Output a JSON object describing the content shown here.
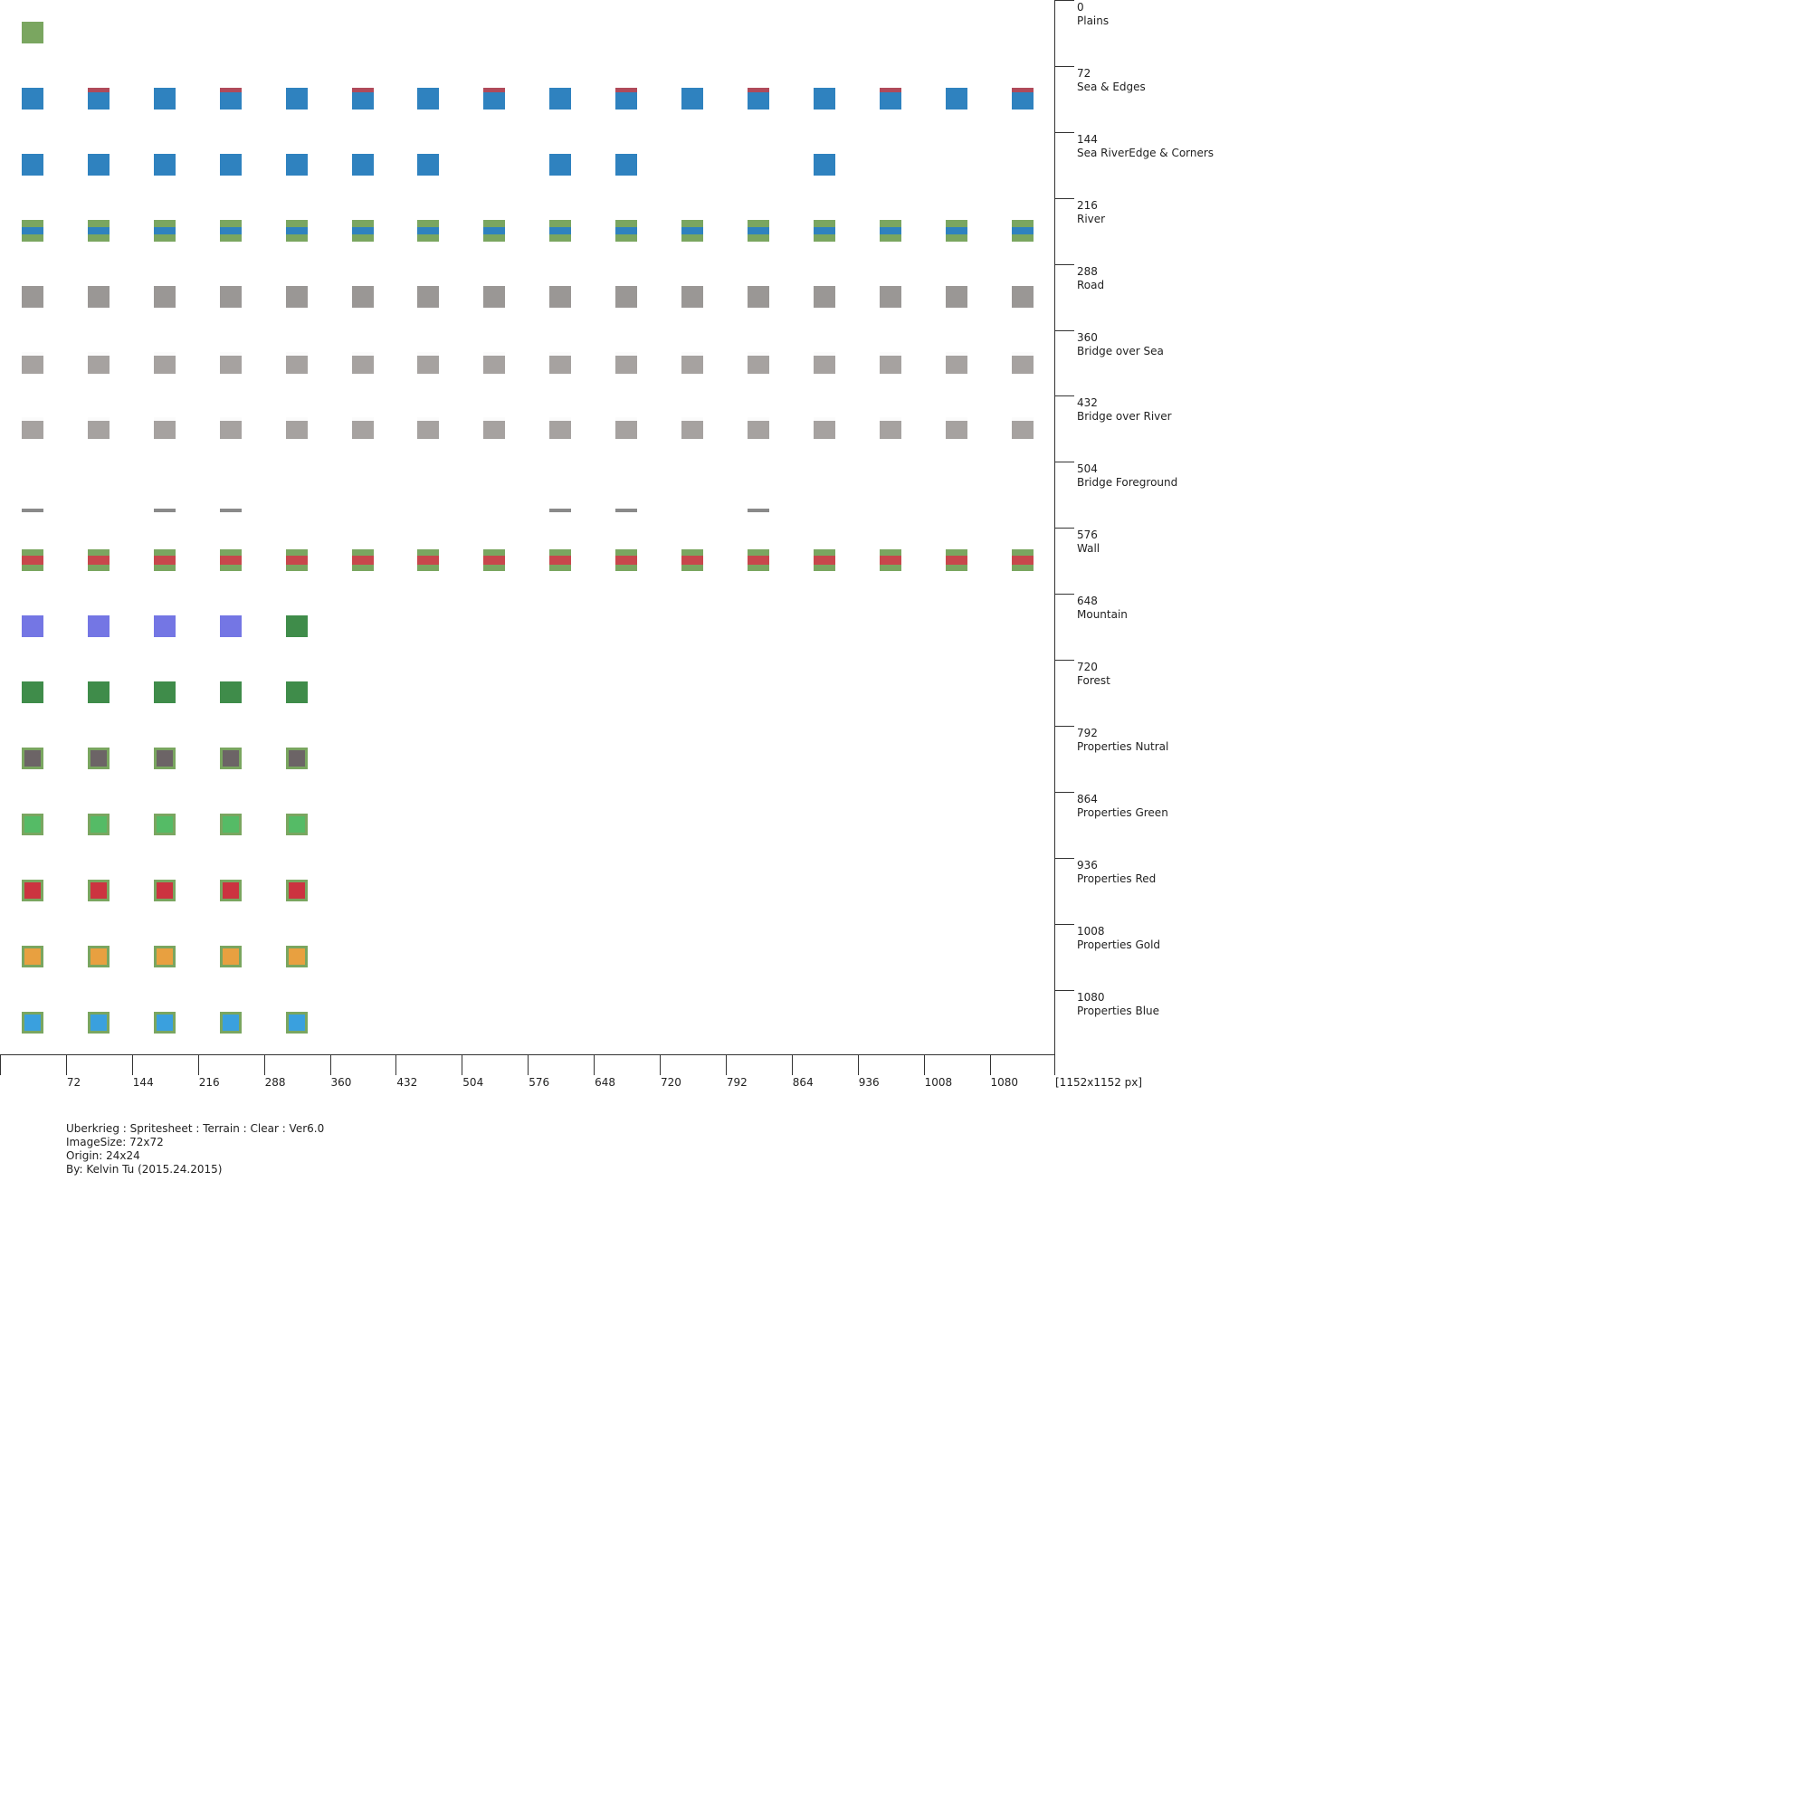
{
  "rows": [
    {
      "offset": "0",
      "label": "Plains"
    },
    {
      "offset": "72",
      "label": "Sea & Edges"
    },
    {
      "offset": "144",
      "label": "Sea RiverEdge & Corners"
    },
    {
      "offset": "216",
      "label": "River"
    },
    {
      "offset": "288",
      "label": "Road"
    },
    {
      "offset": "360",
      "label": "Bridge over Sea"
    },
    {
      "offset": "432",
      "label": "Bridge over River"
    },
    {
      "offset": "504",
      "label": "Bridge Foreground"
    },
    {
      "offset": "576",
      "label": "Wall"
    },
    {
      "offset": "648",
      "label": "Mountain"
    },
    {
      "offset": "720",
      "label": "Forest"
    },
    {
      "offset": "792",
      "label": "Properties Nutral"
    },
    {
      "offset": "864",
      "label": "Properties Green"
    },
    {
      "offset": "936",
      "label": "Properties Red"
    },
    {
      "offset": "1008",
      "label": "Properties Gold"
    },
    {
      "offset": "1080",
      "label": "Properties Blue"
    }
  ],
  "x_ticks": [
    "72",
    "144",
    "216",
    "288",
    "360",
    "432",
    "504",
    "576",
    "648",
    "720",
    "792",
    "864",
    "936",
    "1008",
    "1080"
  ],
  "size_label": "[1152x1152 px]",
  "credits": {
    "title": "Uberkrieg : Spritesheet : Terrain : Clear : Ver6.0",
    "image_size": "ImageSize: 72x72",
    "origin": "Origin: 24x24",
    "author": "By: Kelvin Tu (2015.24.2015)"
  }
}
